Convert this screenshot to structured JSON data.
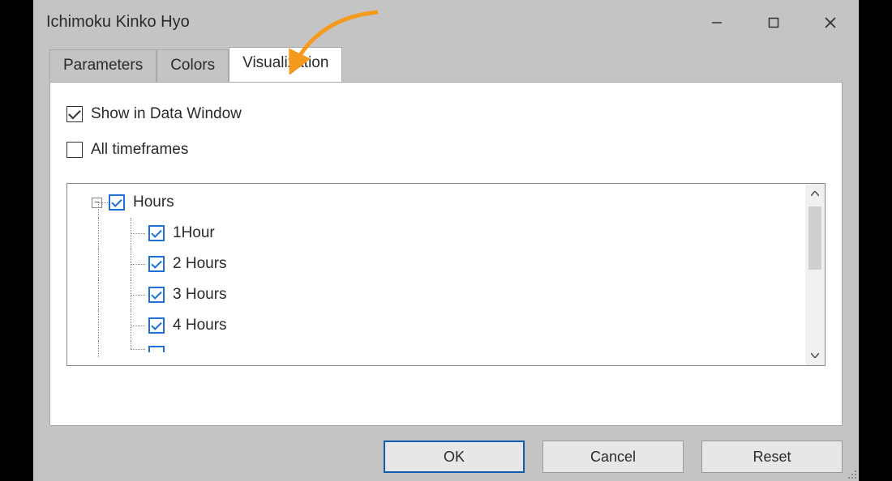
{
  "title": "Ichimoku Kinko Hyo",
  "tabs": {
    "parameters": "Parameters",
    "colors": "Colors",
    "visualization": "Visualization"
  },
  "options": {
    "showInDataWindow": "Show in Data Window",
    "allTimeframes": "All timeframes"
  },
  "tree": {
    "hours": "Hours",
    "children": [
      "1Hour",
      "2 Hours",
      "3 Hours",
      "4 Hours"
    ]
  },
  "buttons": {
    "ok": "OK",
    "cancel": "Cancel",
    "reset": "Reset"
  }
}
